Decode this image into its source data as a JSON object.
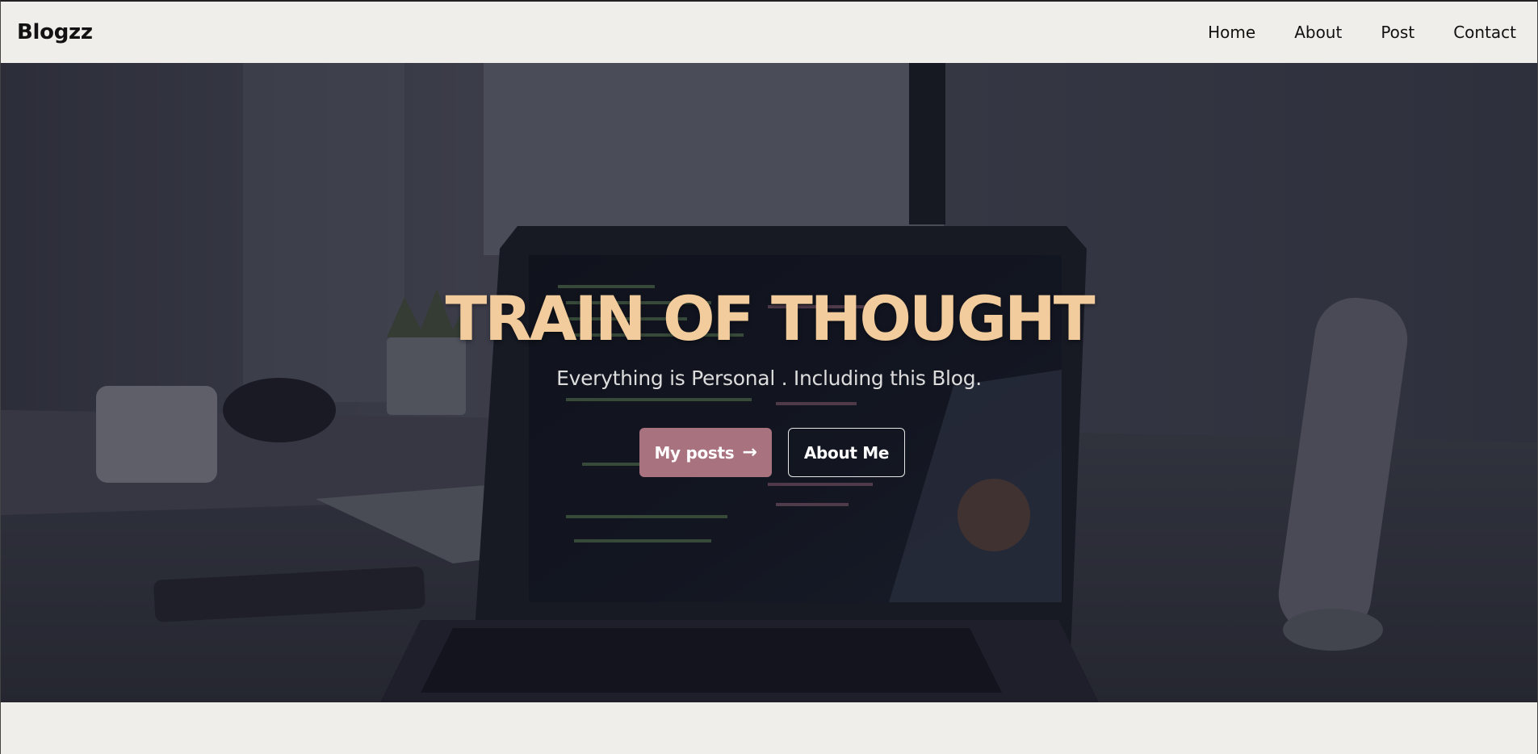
{
  "nav": {
    "brand": "Blogzz",
    "links": [
      "Home",
      "About",
      "Post",
      "Contact"
    ]
  },
  "hero": {
    "title": "TRAIN OF THOUGHT",
    "subtitle": "Everything is Personal . Including this Blog.",
    "primary_button": "My posts",
    "primary_icon": "arrow-right-icon",
    "secondary_button": "About Me"
  },
  "colors": {
    "title": "#f2cc9c",
    "primary_button": "#a8727f",
    "nav_background": "#efeeea"
  }
}
